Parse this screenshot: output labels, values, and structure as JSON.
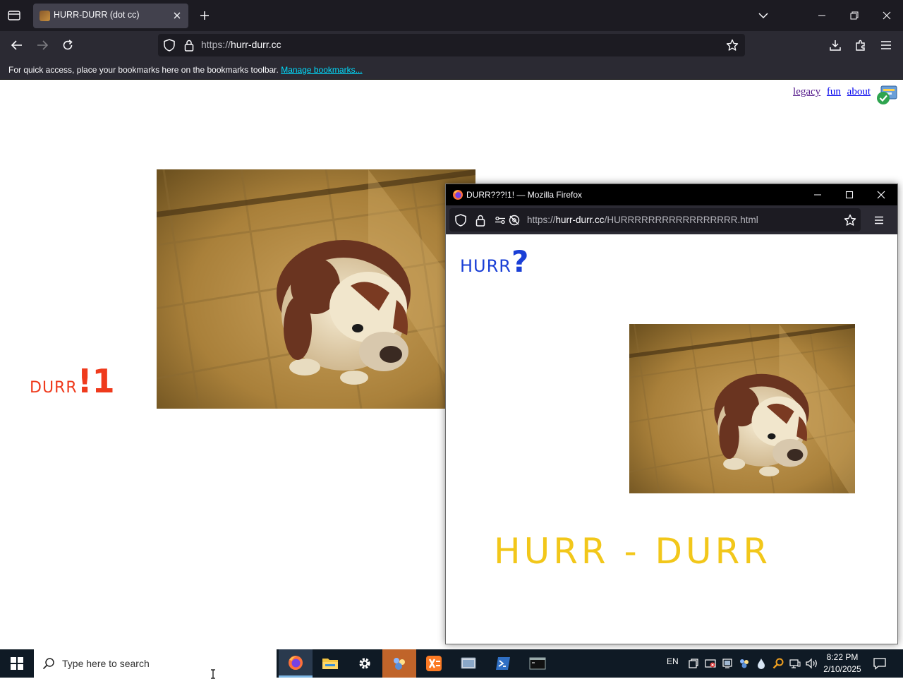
{
  "browser": {
    "tab_title": "HURR-DURR (dot cc)",
    "url_scheme": "https://",
    "url_host": "hurr-durr.cc",
    "bookmarks_hint": "For quick access, place your bookmarks here on the bookmarks toolbar.",
    "bookmarks_link": "Manage bookmarks..."
  },
  "page": {
    "links": {
      "legacy": "legacy",
      "fun": "fun",
      "about": "about"
    },
    "durr_small": "DURR",
    "durr_big": "!1"
  },
  "popup": {
    "title": "DURR???!1! — Mozilla Firefox",
    "url_scheme": "https://",
    "url_host": "hurr-durr.cc",
    "url_path": "/HURRRRRRRRRRRRRRRRR.html",
    "hurr_small": "HURR",
    "hurr_big": "?",
    "banner": "HURR - DURR"
  },
  "taskbar": {
    "search_placeholder": "Type here to search",
    "language": "EN",
    "time": "8:22 PM",
    "date": "2/10/2025"
  },
  "colors": {
    "durr": "#ef3a1c",
    "hurr": "#1a3fd6",
    "banner": "#f2c71a",
    "link_visited": "#551a8b",
    "link": "#0000ee"
  }
}
